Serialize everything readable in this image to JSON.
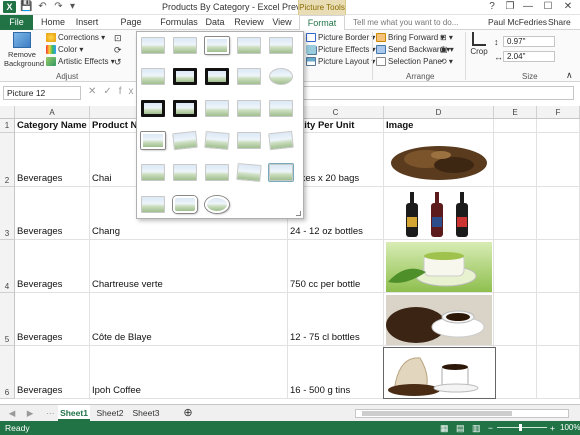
{
  "window": {
    "title": "Products By Category - Excel Preview",
    "context_group": "Picture Tools",
    "app_letter": "X",
    "controls": {
      "help": "?",
      "restore": "❐",
      "minimize": "—",
      "maximize": "☐",
      "close": "✕"
    }
  },
  "quick_access": {
    "save": "💾",
    "undo": "↶",
    "redo": "↷",
    "more": "▾"
  },
  "tabs": [
    {
      "label": "File"
    },
    {
      "label": "Home"
    },
    {
      "label": "Insert"
    },
    {
      "label": "Page Layout"
    },
    {
      "label": "Formulas"
    },
    {
      "label": "Data"
    },
    {
      "label": "Review"
    },
    {
      "label": "View"
    },
    {
      "label": "Format"
    }
  ],
  "tell_me": {
    "placeholder": "Tell me what you want to do..."
  },
  "user": {
    "name": "Paul McFedries",
    "share": "Share"
  },
  "ribbon": {
    "remove_background": "Remove Background",
    "corrections": "Corrections",
    "color": "Color",
    "artistic_effects": "Artistic Effects",
    "adjust_label": "Adjust",
    "picture_border": "Picture Border",
    "picture_effects": "Picture Effects",
    "picture_layout": "Picture Layout",
    "bring_forward": "Bring Forward",
    "send_backward": "Send Backward",
    "selection_pane": "Selection Pane",
    "arrange_label": "Arrange",
    "crop": "Crop",
    "height": "0.97\"",
    "width": "2.04\"",
    "size_label": "Size"
  },
  "formula_bar": {
    "name_box": "Picture 12",
    "icons": "✕✓fx"
  },
  "columns": [
    "A",
    "B",
    "C",
    "D",
    "E",
    "F"
  ],
  "rows": [
    {
      "num": "1",
      "a": "Category Name",
      "b": "Product N",
      "c": "antity Per Unit",
      "d": "Image"
    },
    {
      "num": "2",
      "a": "Beverages",
      "b": "Chai",
      "c": "boxes x 20 bags"
    },
    {
      "num": "3",
      "a": "Beverages",
      "b": "Chang",
      "c": "24 - 12 oz bottles"
    },
    {
      "num": "4",
      "a": "Beverages",
      "b": "Chartreuse verte",
      "c": "750 cc per bottle"
    },
    {
      "num": "5",
      "a": "Beverages",
      "b": "Côte de Blaye",
      "c": "12 - 75 cl bottles"
    },
    {
      "num": "6",
      "a": "Beverages",
      "b": "Ipoh Coffee",
      "c": "16 - 500 g tins"
    }
  ],
  "sheets": [
    "Sheet1",
    "Sheet2",
    "Sheet3"
  ],
  "add_sheet": "⊕",
  "status": {
    "ready": "Ready",
    "zoom": "100%"
  },
  "colors": {
    "excel_green": "#217346",
    "context_tab": "#e8ddb5"
  }
}
